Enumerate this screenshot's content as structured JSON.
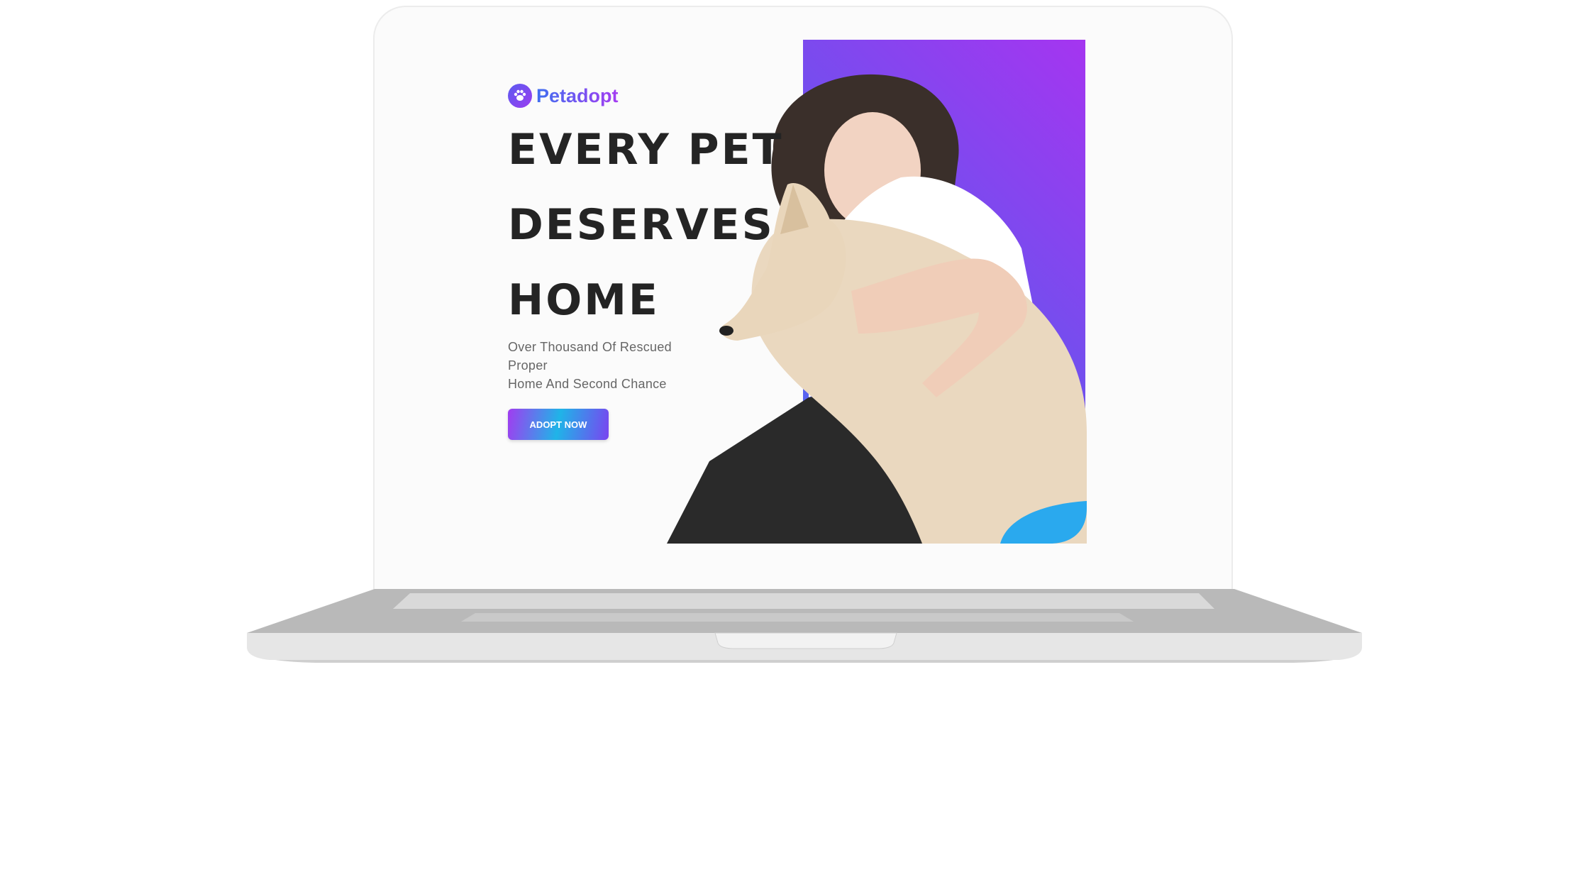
{
  "site": {
    "brand": "Petadopt",
    "headline": [
      "EVERY PET",
      "DESERVES",
      "HOME"
    ],
    "subtext": [
      "Over Thousand Of Rescued",
      "Proper",
      "Home And Second Chance"
    ],
    "cta_label": "ADOPT NOW"
  },
  "icons": {
    "brand": "paw-icon"
  },
  "colors": {
    "brand_gradient_start": "#3f6ff0",
    "brand_gradient_end": "#a53cf2",
    "headline": "#242424",
    "subtext": "#666666",
    "cta_gradient": [
      "#a13cf0",
      "#1fb4e8",
      "#7a44f0"
    ],
    "hero_gradient": [
      "#a535f0",
      "#6c52ee",
      "#4f6ff2"
    ]
  }
}
